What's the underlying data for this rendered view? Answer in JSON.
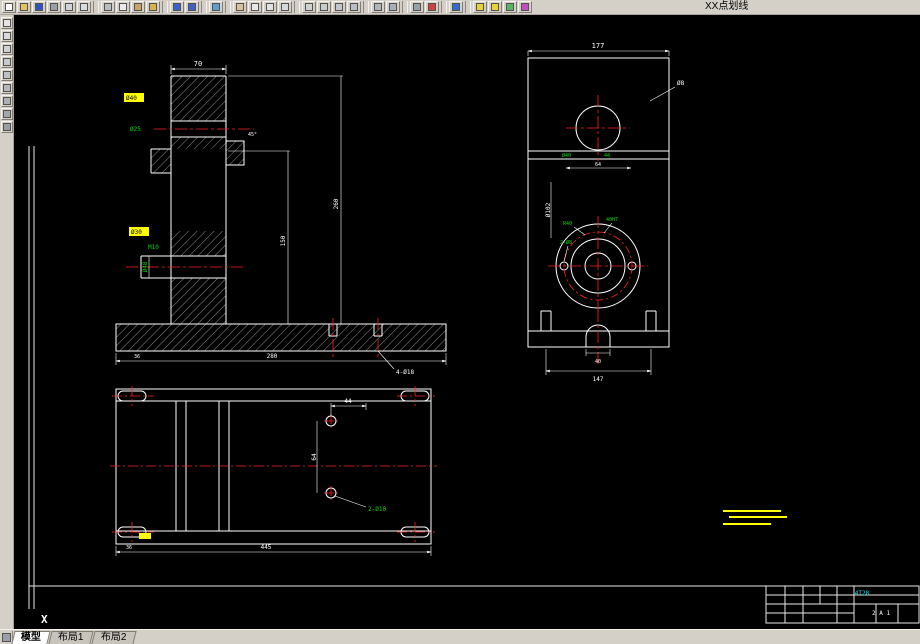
{
  "app": {
    "bg": "#d4d0c8",
    "canvas_bg": "#000000"
  },
  "toolbar": {
    "linetype_label": "XX点划线",
    "items": [
      {
        "name": "new-file-icon",
        "color": "#ffffff"
      },
      {
        "name": "open-file-icon",
        "color": "#e6c35c"
      },
      {
        "name": "save-icon",
        "color": "#2f55c4"
      },
      {
        "name": "plot-icon",
        "color": "#9aa0a8"
      },
      {
        "name": "plot-preview-icon",
        "color": "#cfd4da"
      },
      {
        "name": "spell-check-icon",
        "color": "#d9dde2"
      },
      {
        "type": "sep"
      },
      {
        "name": "cut-icon",
        "color": "#b9bec4"
      },
      {
        "name": "copy-icon",
        "color": "#e8eaec"
      },
      {
        "name": "paste-icon",
        "color": "#caa36a"
      },
      {
        "name": "match-properties-icon",
        "color": "#d8b24a"
      },
      {
        "type": "sep"
      },
      {
        "name": "undo-icon",
        "color": "#3a62c8"
      },
      {
        "name": "redo-icon",
        "color": "#3a62c8"
      },
      {
        "type": "sep"
      },
      {
        "name": "insert-hyperlink-icon",
        "color": "#5aa0d8"
      },
      {
        "type": "sep"
      },
      {
        "name": "pan-icon",
        "color": "#d8c29a"
      },
      {
        "name": "zoom-realtime-icon",
        "color": "#e6e8ea"
      },
      {
        "name": "zoom-window-icon",
        "color": "#dfe2e5"
      },
      {
        "name": "zoom-previous-icon",
        "color": "#d4d8db"
      },
      {
        "type": "sep"
      },
      {
        "name": "redraw-icon",
        "color": "#cdd2d6"
      },
      {
        "name": "regen-icon",
        "color": "#c6ccd1"
      },
      {
        "name": "named-views-icon",
        "color": "#c0c6cb"
      },
      {
        "name": "orbit-icon",
        "color": "#b8bfc5"
      },
      {
        "type": "sep"
      },
      {
        "name": "distance-icon",
        "color": "#aeb6bd"
      },
      {
        "name": "area-icon",
        "color": "#a6afb7"
      },
      {
        "type": "sep"
      },
      {
        "name": "layer-manager-icon",
        "color": "#98a2ab"
      },
      {
        "name": "color-control-icon",
        "color": "#d04040"
      },
      {
        "type": "sep"
      },
      {
        "name": "help-icon",
        "color": "#2b6fd4"
      },
      {
        "type": "sep"
      },
      {
        "name": "express-tool-a-icon",
        "color": "#e8d23c"
      },
      {
        "name": "express-tool-b-icon",
        "color": "#e8d23c"
      },
      {
        "name": "design-center-icon",
        "color": "#58b468"
      },
      {
        "name": "properties-palette-icon",
        "color": "#c050c0"
      }
    ]
  },
  "side_toolbar": {
    "items": [
      {
        "name": "line-tool-icon",
        "color": "#e2e4e6"
      },
      {
        "name": "polyline-tool-icon",
        "color": "#d8dadd"
      },
      {
        "name": "circle-tool-icon",
        "color": "#cfd2d5"
      },
      {
        "name": "arc-tool-icon",
        "color": "#c6c9cd"
      },
      {
        "name": "rectangle-tool-icon",
        "color": "#bdc1c5"
      },
      {
        "name": "hatch-tool-icon",
        "color": "#b4b8bd"
      },
      {
        "name": "text-tool-icon",
        "color": "#abb0b5"
      },
      {
        "name": "dimension-tool-icon",
        "color": "#a2a7ad"
      },
      {
        "name": "erase-tool-icon",
        "color": "#999fa5"
      }
    ]
  },
  "drawing": {
    "colors": {
      "outline": "#ffffff",
      "centerline": "#ff2020",
      "dim_text": "#ffffff",
      "dim_text_green": "#00d800",
      "highlight": "#ffff00",
      "title_text": "#00e0e0"
    },
    "views": {
      "section": {
        "dim_top_width": "70",
        "dim_height": "260",
        "dim_inner_height": "150",
        "dim_hole_top": "Ø25",
        "dim_thread": "M10",
        "dim_bore": "Ø48",
        "dim_chamfer": "45°",
        "tag_upper": "Ø40",
        "tag_lower": "Ø30",
        "dim_base_width": "280",
        "dim_base_left": "36",
        "note_slots": "4-Ø18"
      },
      "front": {
        "dim_top_width": "177",
        "leader_corner": "Ø8",
        "dim_step": "Ø40",
        "dim_step_b": "44",
        "dim_step_c": "64",
        "dim_left_vert": "Ø102",
        "label_radius": "R40",
        "label_bore": "40H7",
        "label_holes": "2-Ø8",
        "dim_notch": "40",
        "dim_bottom_width": "147"
      },
      "top": {
        "dim_hole_h": "44",
        "dim_hole_v": "64",
        "note_holes": "2-Ø10",
        "dim_total": "445",
        "dim_left": "36"
      }
    }
  },
  "ucs": {
    "label": "X"
  },
  "title_block": {
    "code": "4T28",
    "sheet": "2 A 1"
  },
  "tabs": {
    "items": [
      {
        "name": "tab-model",
        "label": "模型",
        "active": true
      },
      {
        "name": "tab-layout1",
        "label": "布局1"
      },
      {
        "name": "tab-layout2",
        "label": "布局2"
      }
    ]
  }
}
